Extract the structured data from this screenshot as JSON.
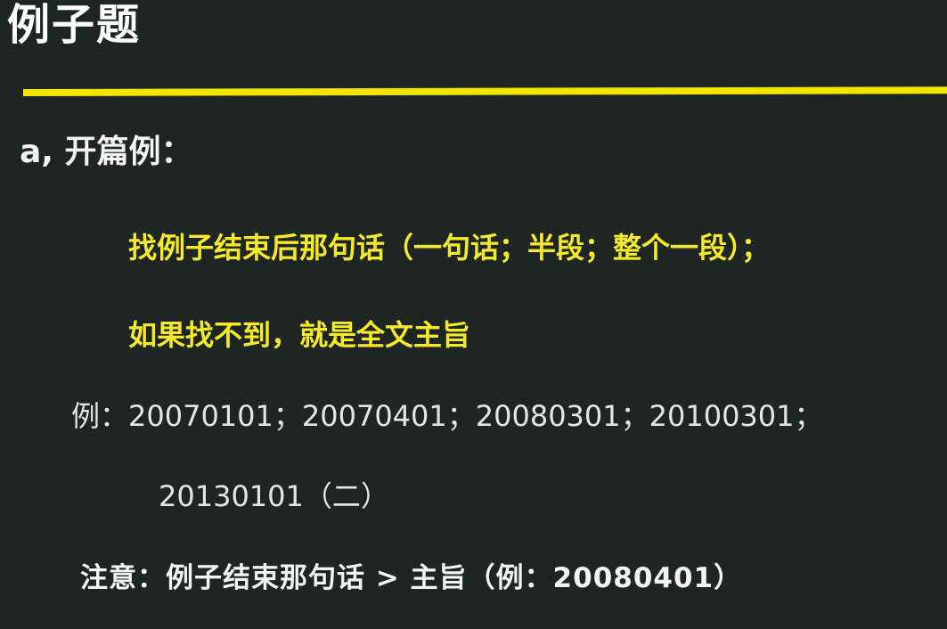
{
  "slide": {
    "title": "例子题",
    "accent_color": "#f2e600",
    "background_color": "#1e2624",
    "section_heading": "a, 开篇例：",
    "rules": [
      "找例子结束后那句话（一句话；半段；整个一段）；",
      "如果找不到，就是全文主旨"
    ],
    "examples_line_1": "例：20070101；20070401；20080301；20100301；",
    "examples_line_2": "20130101（二）",
    "note": "注意：例子结束那句话 > 主旨（例：20080401）"
  }
}
